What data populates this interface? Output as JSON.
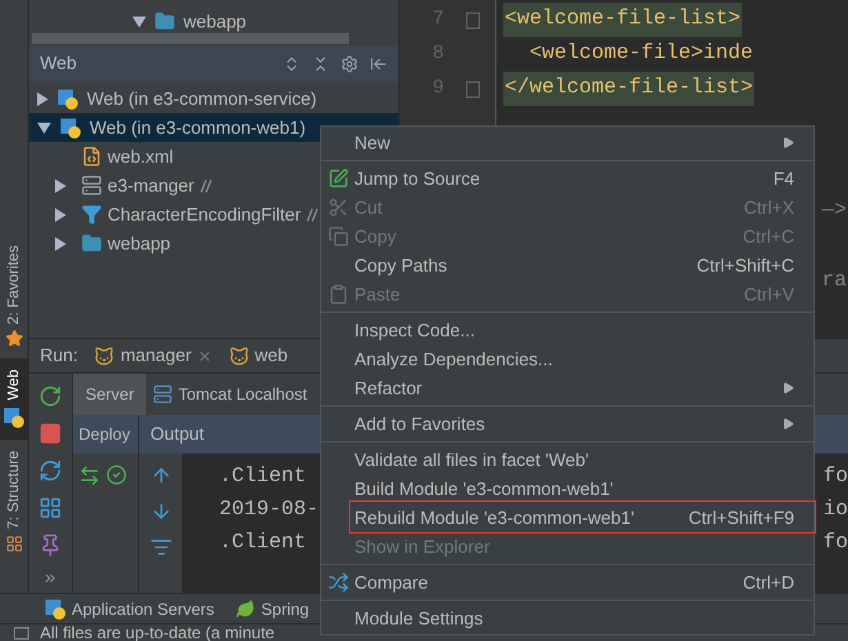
{
  "project_tree": {
    "items": [
      {
        "label": "webapp",
        "expanded": true
      }
    ]
  },
  "web_panel": {
    "title": "Web",
    "items": [
      {
        "label": "Web (in e3-common-service)",
        "kind": "web",
        "expanded": false,
        "selected": false
      },
      {
        "label": "Web (in e3-common-web1)",
        "kind": "web",
        "expanded": true,
        "selected": true,
        "children": [
          {
            "label": "web.xml",
            "kind": "xml",
            "expandable": false
          },
          {
            "label": "e3-manger",
            "kind": "server",
            "expandable": true,
            "link": true
          },
          {
            "label": "CharacterEncodingFilter",
            "kind": "filter",
            "expandable": true,
            "link": true
          },
          {
            "label": "webapp",
            "kind": "folder",
            "expandable": true,
            "link": false
          }
        ]
      }
    ]
  },
  "editor": {
    "lines": [
      {
        "number": "7",
        "code": "<welcome-file-list>",
        "fold": true,
        "highlight": true
      },
      {
        "number": "8",
        "code": "  <welcome-file>inde",
        "fold": false,
        "highlight": false
      },
      {
        "number": "9",
        "code": "</welcome-file-list>",
        "fold": true,
        "highlight": true
      }
    ],
    "fragments": [
      "—>",
      "ra"
    ]
  },
  "side_tabs": [
    {
      "label": "2: Favorites",
      "selected": false
    },
    {
      "label": "Web",
      "selected": true
    },
    {
      "label": "7: Structure",
      "selected": false
    }
  ],
  "run_panel": {
    "label": "Run:",
    "tabs": [
      {
        "label": "manager",
        "closable": true
      },
      {
        "label": "web",
        "closable": false
      }
    ],
    "server_tabs": [
      {
        "label": "Server",
        "selected": true
      },
      {
        "label": "Tomcat Localhost",
        "selected": false
      }
    ],
    "deploy_header": "Deploy",
    "output_header": "Output",
    "console_lines": [
      {
        "left": ".Client",
        "right": "fo"
      },
      {
        "left": "2019-08-",
        "right": "io"
      },
      {
        "left": ".Client",
        "right": "fo"
      }
    ]
  },
  "context_menu": [
    {
      "kind": "item",
      "label": "New",
      "submenu": true,
      "disabled": false
    },
    {
      "kind": "separator"
    },
    {
      "kind": "jump",
      "label": "Jump to Source",
      "shortcut": "F4",
      "disabled": false
    },
    {
      "kind": "cut",
      "label": "Cut",
      "shortcut": "Ctrl+X",
      "disabled": true
    },
    {
      "kind": "copy",
      "label": "Copy",
      "shortcut": "Ctrl+C",
      "disabled": true
    },
    {
      "kind": "item",
      "label": "Copy Paths",
      "shortcut": "Ctrl+Shift+C",
      "disabled": false
    },
    {
      "kind": "paste",
      "label": "Paste",
      "shortcut": "Ctrl+V",
      "disabled": true
    },
    {
      "kind": "separator"
    },
    {
      "kind": "item",
      "label": "Inspect Code...",
      "disabled": false
    },
    {
      "kind": "item",
      "label": "Analyze Dependencies...",
      "disabled": false
    },
    {
      "kind": "item",
      "label": "Refactor",
      "submenu": true,
      "disabled": false
    },
    {
      "kind": "separator"
    },
    {
      "kind": "item",
      "label": "Add to Favorites",
      "submenu": true,
      "disabled": false
    },
    {
      "kind": "separator"
    },
    {
      "kind": "item",
      "label": "Validate all files in facet 'Web'",
      "disabled": false
    },
    {
      "kind": "item",
      "label": "Build Module 'e3-common-web1'",
      "disabled": false
    },
    {
      "kind": "item",
      "label": "Rebuild Module 'e3-common-web1'",
      "shortcut": "Ctrl+Shift+F9",
      "disabled": false,
      "highlighted": true
    },
    {
      "kind": "item",
      "label": "Show in Explorer",
      "disabled": true
    },
    {
      "kind": "separator"
    },
    {
      "kind": "compare",
      "label": "Compare",
      "shortcut": "Ctrl+D",
      "disabled": false
    },
    {
      "kind": "separator"
    },
    {
      "kind": "item",
      "label": "Module Settings",
      "disabled": false
    }
  ],
  "bottom_tabs": [
    {
      "label": "Application Servers"
    },
    {
      "label": "Spring"
    }
  ],
  "status_bar": "All files are up-to-date (a minute"
}
